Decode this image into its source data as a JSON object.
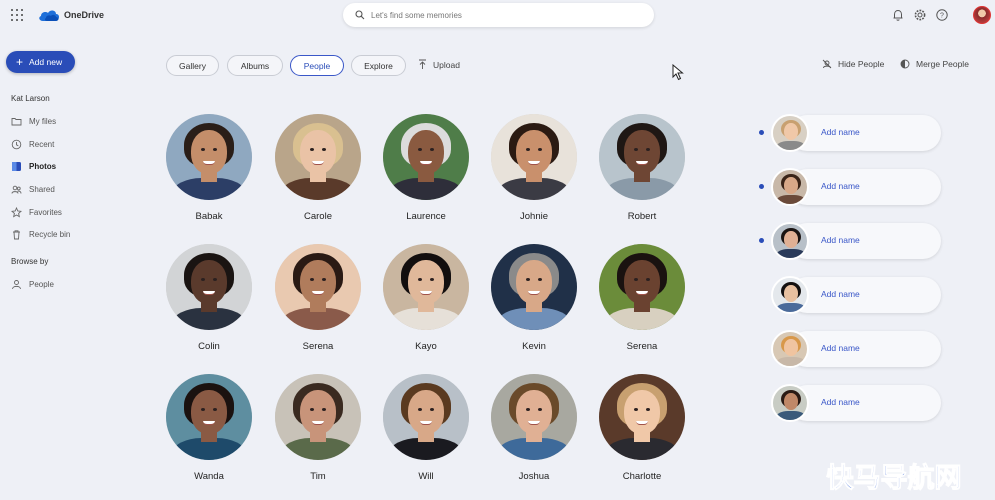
{
  "app": {
    "name": "OneDrive"
  },
  "search": {
    "placeholder": "Let's find some memories"
  },
  "sidebar": {
    "add_new": "Add new",
    "user": "Kat Larson",
    "items": [
      {
        "label": "My files",
        "icon": "folder-icon"
      },
      {
        "label": "Recent",
        "icon": "clock-icon"
      },
      {
        "label": "Photos",
        "icon": "photos-icon",
        "active": true
      },
      {
        "label": "Shared",
        "icon": "people-icon"
      },
      {
        "label": "Favorites",
        "icon": "star-icon"
      },
      {
        "label": "Recycle bin",
        "icon": "trash-icon"
      }
    ],
    "browse_by": "Browse by",
    "browse_items": [
      {
        "label": "People",
        "icon": "person-icon"
      }
    ]
  },
  "tabs": [
    {
      "label": "Gallery"
    },
    {
      "label": "Albums"
    },
    {
      "label": "People",
      "active": true
    },
    {
      "label": "Explore"
    }
  ],
  "toolbar": {
    "upload": "Upload",
    "hide_people": "Hide People",
    "merge_people": "Merge People"
  },
  "people": [
    {
      "name": "Babak"
    },
    {
      "name": "Carole"
    },
    {
      "name": "Laurence"
    },
    {
      "name": "Johnie"
    },
    {
      "name": "Robert"
    },
    {
      "name": "Colin"
    },
    {
      "name": "Serena"
    },
    {
      "name": "Kayo"
    },
    {
      "name": "Kevin"
    },
    {
      "name": "Serena"
    },
    {
      "name": "Wanda"
    },
    {
      "name": "Tim"
    },
    {
      "name": "Will"
    },
    {
      "name": "Joshua"
    },
    {
      "name": "Charlotte"
    }
  ],
  "suggestions": [
    {
      "label": "Add name",
      "unread": true
    },
    {
      "label": "Add name",
      "unread": true
    },
    {
      "label": "Add name",
      "unread": true
    },
    {
      "label": "Add name",
      "unread": false
    },
    {
      "label": "Add name",
      "unread": false
    },
    {
      "label": "Add name",
      "unread": false
    }
  ],
  "watermark": "快马导航网",
  "colors": {
    "accent": "#2a4db8",
    "link": "#3a57c8",
    "background": "#eef0f6"
  }
}
